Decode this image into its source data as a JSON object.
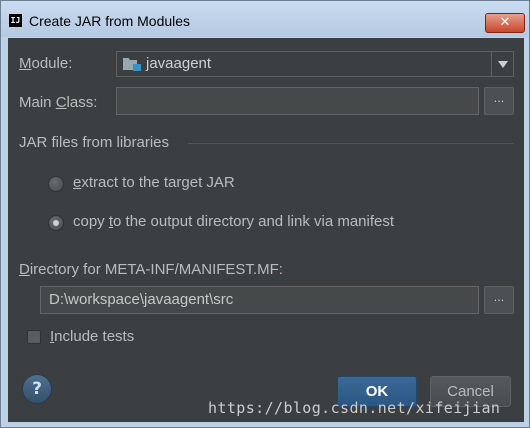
{
  "window": {
    "title": "Create JAR from Modules",
    "app_icon_glyph": "IJ",
    "close_glyph": "✕"
  },
  "module": {
    "label_prefix": "",
    "label_underlined": "M",
    "label_rest": "odule:",
    "value": "javaagent",
    "icon": "module-folder-icon"
  },
  "main_class": {
    "label_prefix": "Main ",
    "label_underlined": "C",
    "label_rest": "lass:",
    "value": "",
    "browse_label": "..."
  },
  "libraries": {
    "section_title": "JAR files from libraries",
    "options": [
      {
        "underlined": "e",
        "rest": "xtract to the target JAR",
        "checked": false
      },
      {
        "prefix": "copy ",
        "underlined": "t",
        "rest": "o the output directory and link via manifest",
        "checked": true
      }
    ]
  },
  "manifest": {
    "label_underlined": "D",
    "label_rest": "irectory for META-INF/MANIFEST.MF:",
    "value": "D:\\workspace\\javaagent\\src",
    "browse_label": "..."
  },
  "include_tests": {
    "label_underlined": "I",
    "label_rest": "nclude tests",
    "checked": false
  },
  "buttons": {
    "help": "?",
    "ok": "OK",
    "cancel": "Cancel"
  },
  "watermark": "https://blog.csdn.net/xifeijian",
  "colors": {
    "dialog_bg": "#3c3f41",
    "text": "#bbbbbb",
    "ok_button": "#2f5e8c",
    "title_bar": "#bcd0e6",
    "close_button": "#c8462c"
  }
}
